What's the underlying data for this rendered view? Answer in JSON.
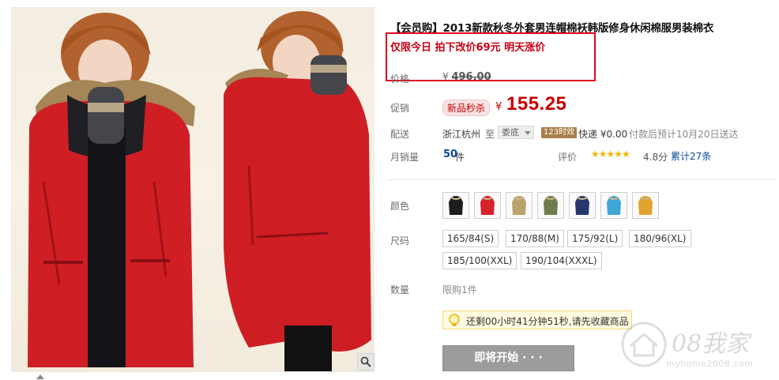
{
  "product": {
    "title": "【会员购】2013新款秋冬外套男连帽棉袄韩版修身休闲棉服男装棉衣",
    "promo_note": "仅限今日 拍下改价69元 明天涨价"
  },
  "price": {
    "label": "价格",
    "currency": "¥",
    "original": "496.00"
  },
  "promotion": {
    "label": "促销",
    "tag": "新品秒杀",
    "currency": "¥",
    "price": "155.25"
  },
  "shipping": {
    "label": "配送",
    "origin": "浙江杭州",
    "to_word": "至",
    "destination": "娄底",
    "badge": "123时效",
    "fee_text": "快递 ¥0.00",
    "eta_text": "付款后预计10月20日送达"
  },
  "sales": {
    "label": "月销量",
    "count": "50",
    "unit": "件"
  },
  "rating": {
    "label": "评价",
    "stars": "★★★★★",
    "score": "4.8分",
    "reviews": "累计27条"
  },
  "color": {
    "label": "颜色",
    "swatches": [
      "black",
      "red",
      "khaki",
      "army-green",
      "navy",
      "sky-blue",
      "yellow"
    ],
    "swatch_colors": [
      "#1d1d1d",
      "#d6222b",
      "#b9a36a",
      "#6e7b4d",
      "#27366a",
      "#3ea7d6",
      "#e0a32c"
    ]
  },
  "size": {
    "label": "尺码",
    "options": [
      "165/84(S)",
      "170/88(M)",
      "175/92(L)",
      "180/96(XL)",
      "185/100(XXL)",
      "190/104(XXXL)"
    ]
  },
  "quantity": {
    "label": "数量",
    "limit": "限购1件"
  },
  "notice": {
    "text": "还剩00小时41分钟51秒,请先收藏商品"
  },
  "cta": {
    "label": "即将开始 · · ·"
  },
  "watermark": {
    "main": "08我家",
    "url": "myhome2008.com"
  }
}
